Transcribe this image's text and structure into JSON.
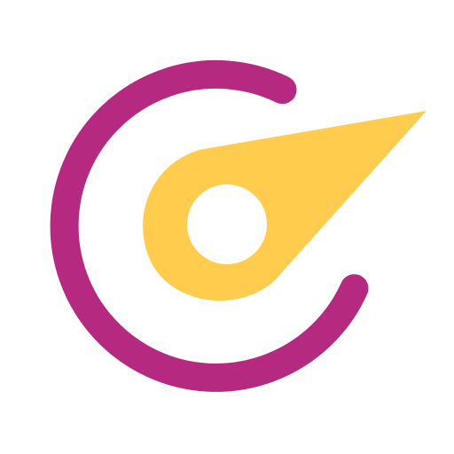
{
  "logo": {
    "icon": "gauge-needle-logo",
    "colors": {
      "background": "#ffffff",
      "arc": "#B52A80",
      "needle": "#FFCC4D",
      "hub": "#ffffff"
    }
  }
}
